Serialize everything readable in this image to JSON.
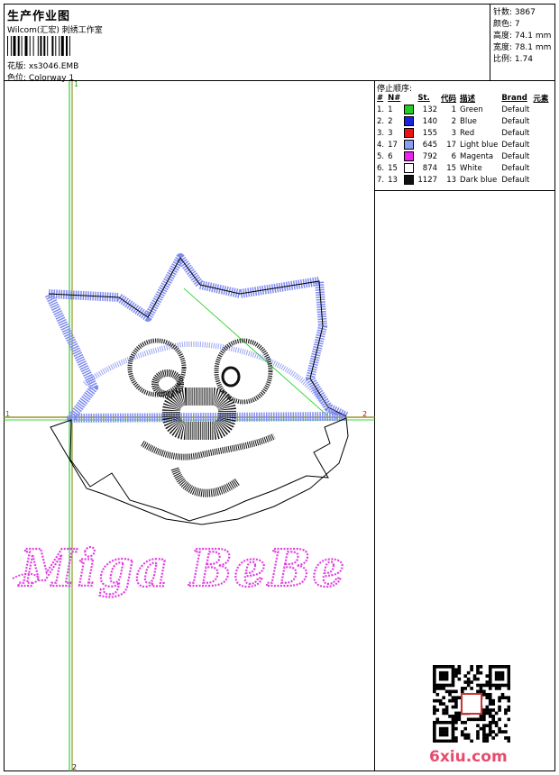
{
  "header": {
    "title": "生产作业图",
    "company": "Wilcom(汇宏) 刺绣工作室",
    "design_label": "花版:",
    "design_file": "xs3046.EMB",
    "colorway_label": "色位:",
    "colorway": "Colorway 1"
  },
  "stats": {
    "stitches_label": "针数:",
    "stitches": "3867",
    "colors_label": "颜色:",
    "colors": "7",
    "height_label": "高度:",
    "height": "74.1 mm",
    "width_label": "宽度:",
    "width": "78.1 mm",
    "scale_label": "比例:",
    "scale": "1.74"
  },
  "sequence": {
    "title": "停止顺序:",
    "headers": [
      "#",
      "N#",
      "St.",
      "代码",
      "描述",
      "Brand",
      "元素"
    ],
    "rows": [
      {
        "idx": "1.",
        "n": "1",
        "st": "132",
        "code": "1",
        "desc": "Green",
        "brand": "Default",
        "color": "#22cc22"
      },
      {
        "idx": "2.",
        "n": "2",
        "st": "140",
        "code": "2",
        "desc": "Blue",
        "brand": "Default",
        "color": "#1a22dd"
      },
      {
        "idx": "3.",
        "n": "3",
        "st": "155",
        "code": "3",
        "desc": "Red",
        "brand": "Default",
        "color": "#ee1111"
      },
      {
        "idx": "4.",
        "n": "17",
        "st": "645",
        "code": "17",
        "desc": "Light blue",
        "brand": "Default",
        "color": "#8c9cf0"
      },
      {
        "idx": "5.",
        "n": "6",
        "st": "792",
        "code": "6",
        "desc": "Magenta",
        "brand": "Default",
        "color": "#ee22ee"
      },
      {
        "idx": "6.",
        "n": "15",
        "st": "874",
        "code": "15",
        "desc": "White",
        "brand": "Default",
        "color": "#ffffff"
      },
      {
        "idx": "7.",
        "n": "13",
        "st": "1127",
        "code": "13",
        "desc": "Dark blue",
        "brand": "Default",
        "color": "#111111"
      }
    ]
  },
  "canvas": {
    "axis_x_start": "1",
    "axis_x_end": "2",
    "axis_y_start": "1",
    "axis_y_end": "2",
    "embroidery_text": "Miga BeBe",
    "text_color": "#e040e0",
    "outline_blue": "#7f8cf0",
    "guide_green": "#00cc00",
    "guide_olive": "#808000"
  },
  "watermark": {
    "text": "6xiu.com",
    "color": "#e84b6b"
  }
}
